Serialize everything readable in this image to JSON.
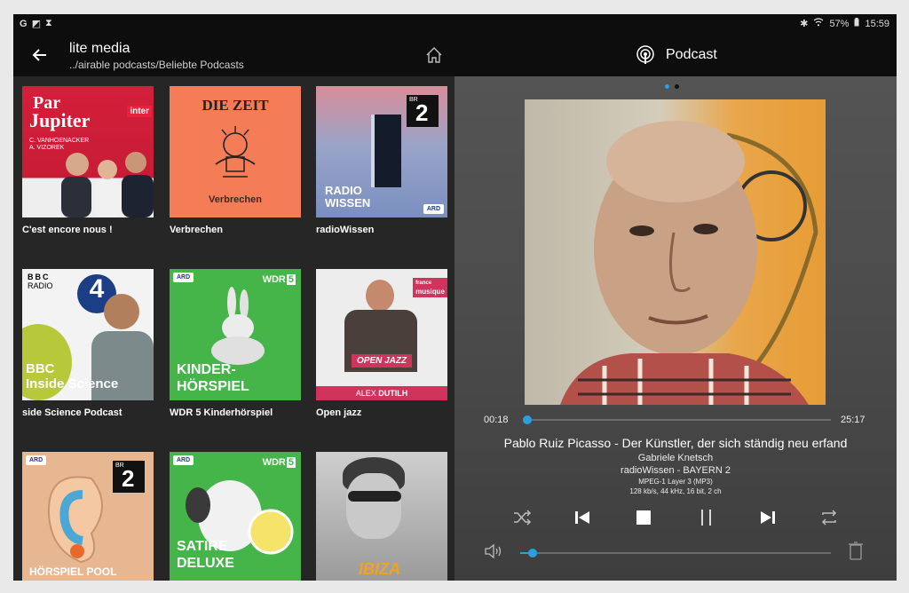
{
  "status": {
    "left_icons": [
      "G",
      "◩",
      "⧗"
    ],
    "battery": "57%",
    "time": "15:59"
  },
  "appbar": {
    "title": "lite media",
    "path": "../airable podcasts/Beliebte Podcasts"
  },
  "player_header": {
    "title": "Podcast"
  },
  "tiles": [
    {
      "label": "C'est encore nous !",
      "art_text": [
        "Par",
        "Jupiter",
        "C. VANHOENACKER",
        "A. VIZOREK",
        "inter"
      ]
    },
    {
      "label": "Verbrechen",
      "art_text": [
        "DIE ZEIT",
        "Verbrechen"
      ]
    },
    {
      "label": "radioWissen",
      "art_text": [
        "RADIO",
        "WISSEN",
        "BR",
        "2",
        "ARD"
      ]
    },
    {
      "label": "side Science Podcast",
      "art_text": [
        "BBC",
        "RADIO",
        "4",
        "BBC",
        "Inside Science"
      ]
    },
    {
      "label": "WDR 5 Kinderhörspiel",
      "art_text": [
        "ARD",
        "WDR",
        "5",
        "KINDER-",
        "HÖRSPIEL"
      ]
    },
    {
      "label": "Open jazz",
      "art_text": [
        "france",
        "musique",
        "OPEN JAZZ",
        "ALEX",
        "DUTILH"
      ]
    },
    {
      "label": "",
      "art_text": [
        "ARD",
        "BR",
        "2",
        "HÖRSPIEL POOL"
      ]
    },
    {
      "label": "",
      "art_text": [
        "ARD",
        "WDR",
        "5",
        "SATIRE",
        "DELUXE"
      ]
    },
    {
      "label": "",
      "art_text": [
        "IBIZA"
      ]
    }
  ],
  "player": {
    "elapsed": "00:18",
    "duration": "25:17",
    "progress": 0.012,
    "volume": 0.04,
    "track_title": "Pablo Ruiz Picasso - Der Künstler, der sich ständig neu erfand",
    "author": "Gabriele Knetsch",
    "station": "radioWissen - BAYERN 2",
    "codec": "MPEG-1 Layer 3 (MP3)",
    "bitrate": "128 kb/s, 44 kHz, 16 bit, 2 ch",
    "page_dots": 2,
    "active_dot": 0
  },
  "icons": {
    "back": "arrow-left-icon",
    "home": "home-icon",
    "podcast": "podcast-icon",
    "shuffle": "shuffle-icon",
    "previous": "skip-previous-icon",
    "stop": "stop-icon",
    "pause": "pause-icon",
    "next": "skip-next-icon",
    "repeat": "repeat-icon",
    "volume": "volume-icon",
    "delete": "trash-icon"
  },
  "colors": {
    "accent": "#2aa0e0",
    "panel_bg": "#262626",
    "bar_bg": "#0d0d0d"
  }
}
